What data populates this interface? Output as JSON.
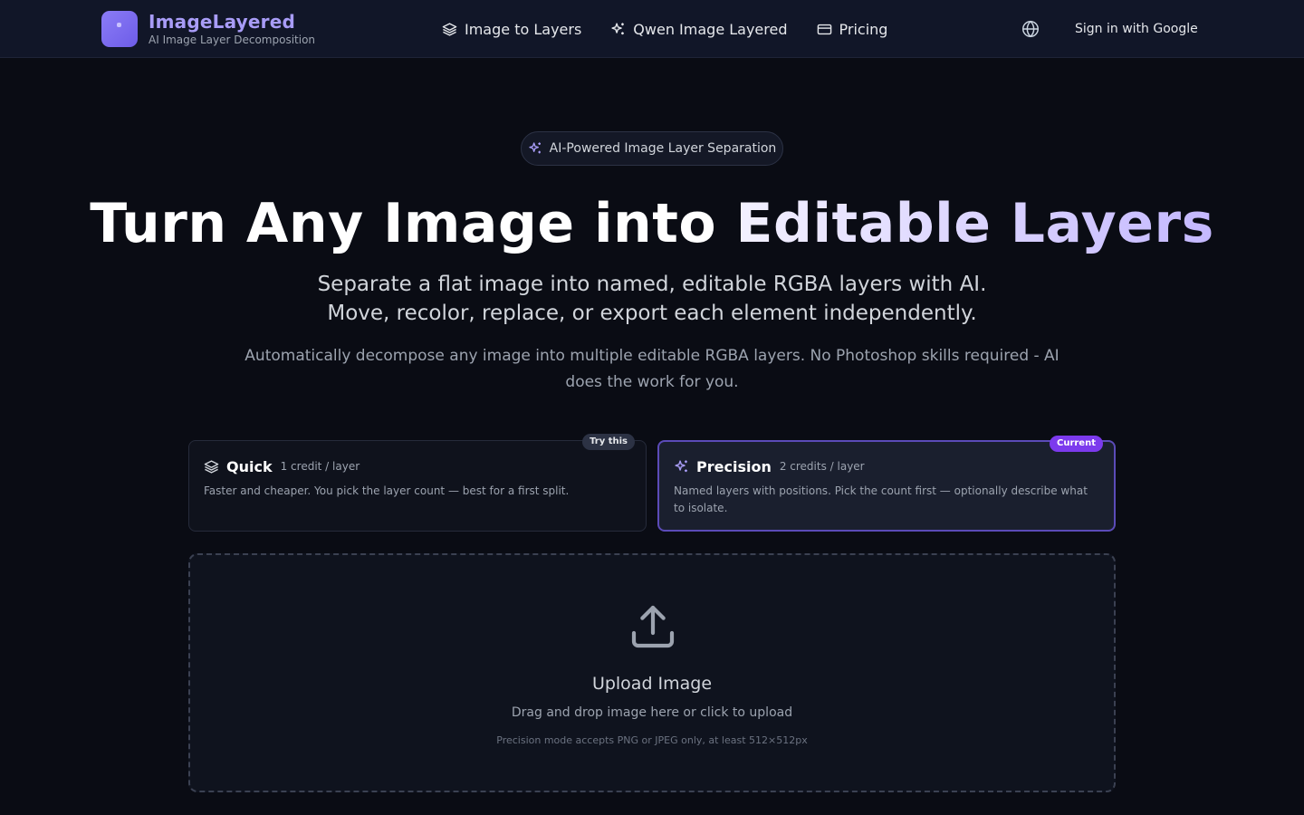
{
  "brand": {
    "name": "ImageLayered",
    "tagline": "AI Image Layer Decomposition",
    "accent": "#8b7cf6"
  },
  "nav": {
    "items": [
      {
        "label": "Image to Layers",
        "icon": "layers-icon"
      },
      {
        "label": "Qwen Image Layered",
        "icon": "sparkles-icon"
      },
      {
        "label": "Pricing",
        "icon": "credit-card-icon"
      }
    ],
    "language_icon": "globe-icon",
    "signin_label": "Sign in with Google"
  },
  "hero": {
    "badge": "AI-Powered Image Layer Separation",
    "title_plain": "Turn Any Image into ",
    "title_highlight": "Editable Layers",
    "subtitle_line1": "Separate a flat image into named, editable RGBA layers with AI.",
    "subtitle_line2": "Move, recolor, replace, or export each element independently.",
    "description": "Automatically decompose any image into multiple editable RGBA layers. No Photoshop skills required - AI does the work for you."
  },
  "modes": {
    "quick": {
      "title": "Quick",
      "cost": "1 credit / layer",
      "description": "Faster and cheaper. You pick the layer count — best for a first split.",
      "tag": "Try this",
      "icon": "layers-icon"
    },
    "precision": {
      "title": "Precision",
      "cost": "2 credits / layer",
      "description": "Named layers with positions. Pick the count first — optionally describe what to isolate.",
      "tag": "Current",
      "icon": "sparkles-icon",
      "selected": true,
      "tag_color": "#7c3aed"
    }
  },
  "upload": {
    "icon": "upload-icon",
    "title": "Upload Image",
    "hint": "Drag and drop image here or click to upload",
    "note": "Precision mode accepts PNG or JPEG only, at least 512×512px"
  }
}
